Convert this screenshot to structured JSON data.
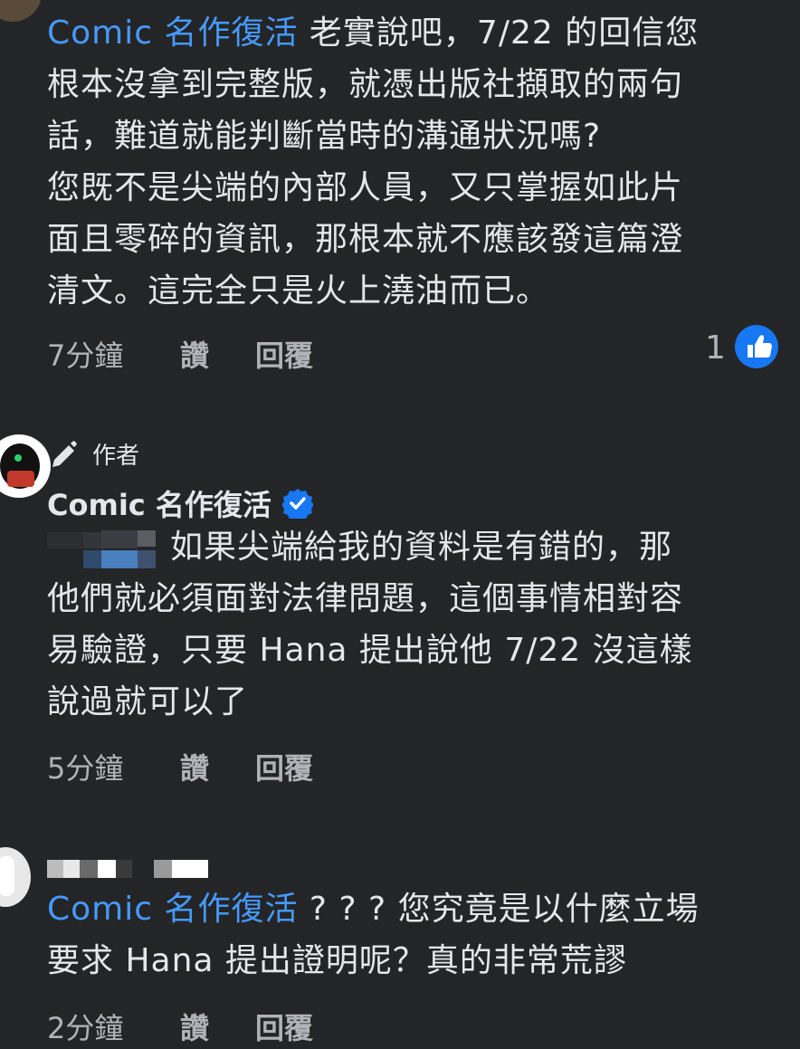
{
  "comment1": {
    "mention": "Comic 名作復活",
    "text_line1": " 老實說吧，7/22 的回信您",
    "text_rest": "根本沒拿到完整版，就憑出版社擷取的兩句\n話，難道就能判斷當時的溝通狀況嗎?\n您既不是尖端的內部人員，又只掌握如此片\n面且零碎的資訊，那根本就不應該發這篇澄\n清文。這完全只是火上澆油而已。",
    "time": "7分鐘",
    "like": "讚",
    "reply": "回覆",
    "reaction_count": "1",
    "like_reaction_icon": "thumbs-up-icon",
    "like_color": "#1877f2"
  },
  "comment2": {
    "author_badge": "作者",
    "author_name": "Comic 名作復活",
    "verified_icon": "verified-badge-icon",
    "verified_color": "#1877f2",
    "text_line1": "如果尖端給我的資料是有錯的，那",
    "text_rest": "他們就必須面對法律問題，這個事情相對容\n易驗證，只要 Hana 提出說他 7/22 沒這樣\n說過就可以了",
    "time": "5分鐘",
    "like": "讚",
    "reply": "回覆"
  },
  "comment3": {
    "mention": "Comic 名作復活",
    "text_line1": " ? ? ? 您究竟是以什麼立場",
    "text_rest": "要求 Hana 提出證明呢？真的非常荒謬",
    "time": "2分鐘",
    "like": "讚",
    "reply": "回覆"
  }
}
